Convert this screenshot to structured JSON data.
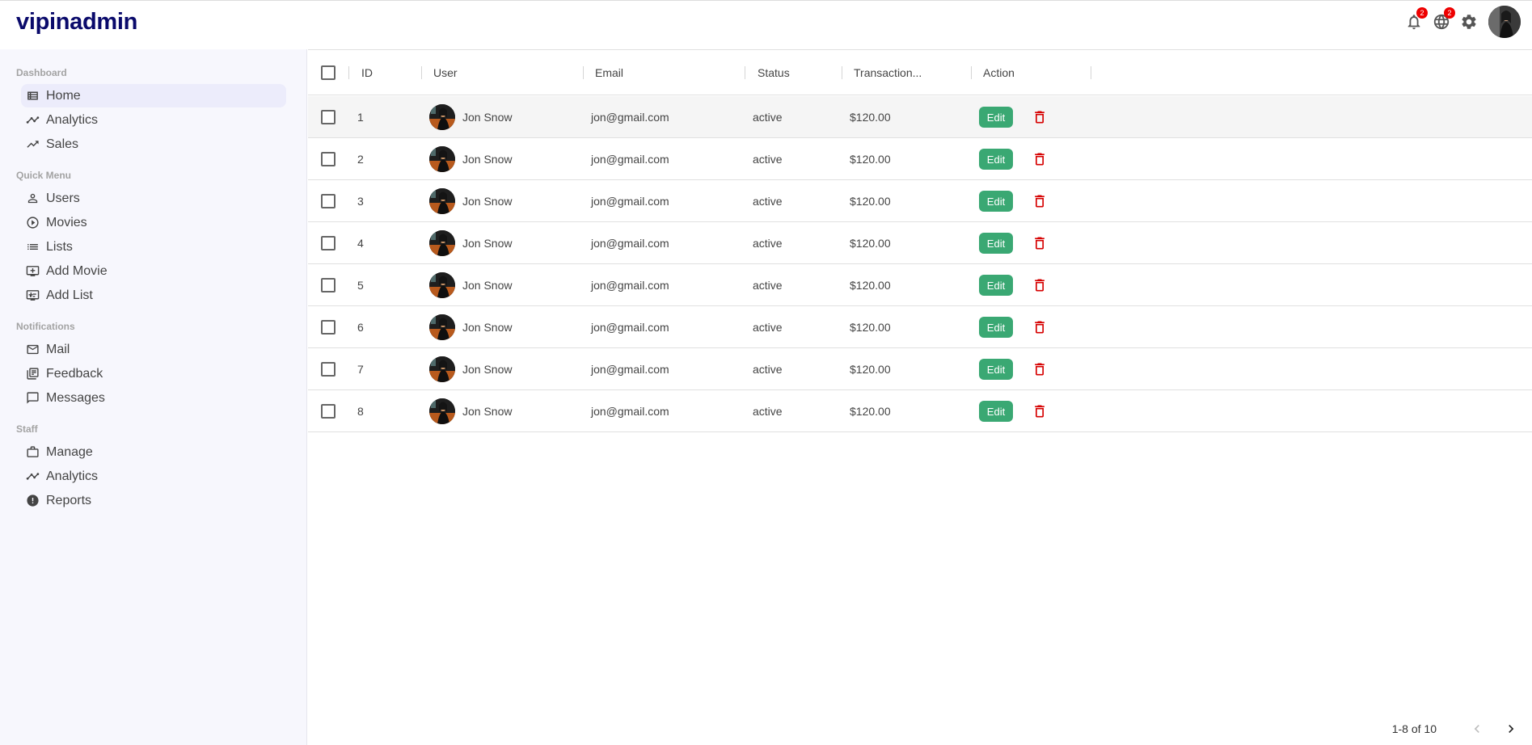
{
  "app": {
    "title": "vipinadmin"
  },
  "topbar": {
    "notifications_count": "2",
    "language_count": "2",
    "icons": [
      "bell-icon",
      "globe-icon",
      "gear-icon",
      "avatar"
    ]
  },
  "sidebar": {
    "sections": [
      {
        "title": "Dashboard",
        "items": [
          {
            "label": "Home",
            "icon": "home-grid-icon",
            "active": true
          },
          {
            "label": "Analytics",
            "icon": "line-chart-icon"
          },
          {
            "label": "Sales",
            "icon": "trending-up-icon"
          }
        ]
      },
      {
        "title": "Quick Menu",
        "items": [
          {
            "label": "Users",
            "icon": "person-icon"
          },
          {
            "label": "Movies",
            "icon": "play-circle-icon"
          },
          {
            "label": "Lists",
            "icon": "list-icon"
          },
          {
            "label": "Add Movie",
            "icon": "add-to-queue-icon"
          },
          {
            "label": "Add List",
            "icon": "add-list-icon"
          }
        ]
      },
      {
        "title": "Notifications",
        "items": [
          {
            "label": "Mail",
            "icon": "mail-icon"
          },
          {
            "label": "Feedback",
            "icon": "feedback-icon"
          },
          {
            "label": "Messages",
            "icon": "chat-icon"
          }
        ]
      },
      {
        "title": "Staff",
        "items": [
          {
            "label": "Manage",
            "icon": "briefcase-icon"
          },
          {
            "label": "Analytics",
            "icon": "line-chart-icon"
          },
          {
            "label": "Reports",
            "icon": "report-icon"
          }
        ]
      }
    ]
  },
  "table": {
    "columns": [
      "ID",
      "User",
      "Email",
      "Status",
      "Transaction...",
      "Action"
    ],
    "edit_label": "Edit",
    "rows": [
      {
        "id": "1",
        "user": "Jon Snow",
        "email": "jon@gmail.com",
        "status": "active",
        "transaction": "$120.00"
      },
      {
        "id": "2",
        "user": "Jon Snow",
        "email": "jon@gmail.com",
        "status": "active",
        "transaction": "$120.00"
      },
      {
        "id": "3",
        "user": "Jon Snow",
        "email": "jon@gmail.com",
        "status": "active",
        "transaction": "$120.00"
      },
      {
        "id": "4",
        "user": "Jon Snow",
        "email": "jon@gmail.com",
        "status": "active",
        "transaction": "$120.00"
      },
      {
        "id": "5",
        "user": "Jon Snow",
        "email": "jon@gmail.com",
        "status": "active",
        "transaction": "$120.00"
      },
      {
        "id": "6",
        "user": "Jon Snow",
        "email": "jon@gmail.com",
        "status": "active",
        "transaction": "$120.00"
      },
      {
        "id": "7",
        "user": "Jon Snow",
        "email": "jon@gmail.com",
        "status": "active",
        "transaction": "$120.00"
      },
      {
        "id": "8",
        "user": "Jon Snow",
        "email": "jon@gmail.com",
        "status": "active",
        "transaction": "$120.00"
      }
    ]
  },
  "pagination": {
    "label": "1-8 of 10"
  },
  "colors": {
    "logo": "#0a0a6b",
    "edit_button": "#3aa873",
    "delete_icon": "#d60000",
    "badge": "#e00000",
    "sidebar_bg": "#f7f7fd"
  }
}
